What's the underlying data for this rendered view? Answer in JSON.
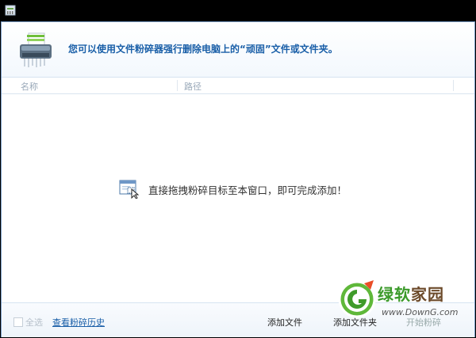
{
  "window": {
    "titlebar_bg": "#000000",
    "accent": "#1a5fa8"
  },
  "header": {
    "icon": "shredder-icon",
    "message": "您可以使用文件粉碎器强行删除电脑上的“顽固”文件或文件夹。"
  },
  "columns": [
    {
      "label": "名称"
    },
    {
      "label": "路径"
    }
  ],
  "list": {
    "items": [],
    "drop_icon": "drag-into-window-icon",
    "drop_hint": "直接拖拽粉碎目标至本窗口，即可完成添加！"
  },
  "footer": {
    "select_all_label": "全选",
    "history_link": "查看粉碎历史",
    "add_file_label": "添加文件",
    "add_folder_label": "添加文件夹",
    "start_label": "开始粉碎"
  },
  "watermark": {
    "brand_green": "绿软",
    "brand_home": "家园",
    "url": "www.DownG.com"
  }
}
